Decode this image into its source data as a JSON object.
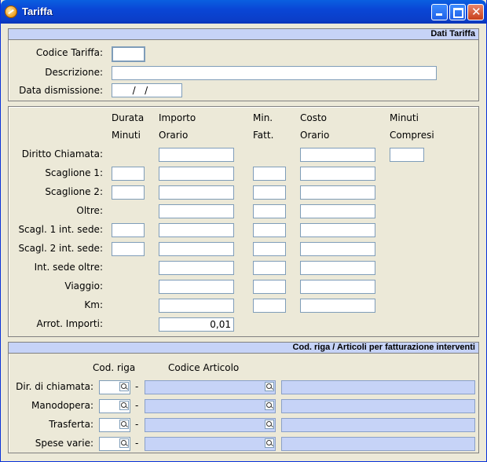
{
  "window": {
    "title": "Tariffa"
  },
  "dati_tariffa": {
    "header": "Dati Tariffa",
    "codice_label": "Codice Tariffa:",
    "codice_value": "",
    "descrizione_label": "Descrizione:",
    "descrizione_value": "",
    "data_label": "Data dismissione:",
    "data_value": "  /   /"
  },
  "tariffe": {
    "headers": {
      "durata_1": "Durata",
      "durata_2": "Minuti",
      "importo_1": "Importo",
      "importo_2": "Orario",
      "min_1": "Min.",
      "min_2": "Fatt.",
      "costo_1": "Costo",
      "costo_2": "Orario",
      "minuti_1": "Minuti",
      "minuti_2": "Compresi"
    },
    "rows": [
      "Diritto Chiamata:",
      "Scaglione 1:",
      "Scaglione 2:",
      "Oltre:",
      "Scagl. 1 int. sede:",
      "Scagl. 2 int. sede:",
      "Int. sede oltre:",
      "Viaggio:",
      "Km:",
      "Arrot. Importi:"
    ],
    "arrot_value": "0,01"
  },
  "articoli": {
    "header": "Cod. riga / Articoli per fatturazione interventi",
    "col_cod_riga": "Cod. riga",
    "col_codice_articolo": "Codice Articolo",
    "separator": "-",
    "rows": [
      {
        "label": "Dir. di chiamata:"
      },
      {
        "label": "Manodopera:"
      },
      {
        "label": "Trasferta:"
      },
      {
        "label": "Spese varie:"
      }
    ]
  }
}
